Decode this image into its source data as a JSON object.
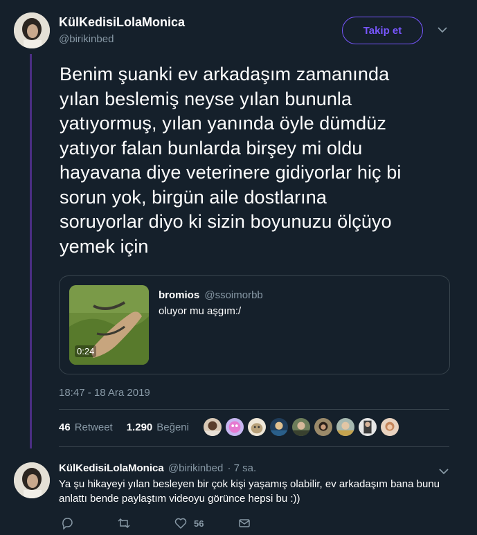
{
  "author": {
    "display_name": "KülKedisiLolaMonica",
    "handle": "@birikinbed"
  },
  "follow_label": "Takip et",
  "tweet": {
    "lines": [
      "Benim şuanki ev arkadaşım zamanında",
      "yılan beslemiş neyse yılan bununla",
      "yatıyormuş, yılan yanında öyle dümdüz",
      "yatıyor falan bunlarda birşey mi oldu",
      "hayavana diye veterinere gidiyorlar hiç bi",
      "sorun yok, birgün aile dostlarına",
      "soruyorlar diyo ki sizin boyunuzu ölçüyo",
      "yemek için"
    ],
    "timestamp": "18:47 - 18 Ara 2019"
  },
  "quote": {
    "name": "bromios",
    "handle": "@ssoimorbb",
    "text": "oluyor mu aşgım:/",
    "video_duration": "0:24"
  },
  "stats": {
    "retweets": "46",
    "retweets_label": "Retweet",
    "likes": "1.290",
    "likes_label": "Beğeni"
  },
  "reply": {
    "display_name": "KülKedisiLolaMonica",
    "handle": "@birikinbed",
    "time": "· 7 sa.",
    "lines": [
      "Ya şu hikayeyi yılan besleyen bir çok kişi yaşamış olabilir, ev arkadaşım bana bunu",
      "anlattı bende paylaştım videoyu görünce hepsi bu :))"
    ],
    "like_count": "56"
  },
  "icons": {
    "chevron": "chevron-down-icon",
    "reply": "reply-icon",
    "retweet": "retweet-icon",
    "like": "heart-icon",
    "dm": "envelope-icon"
  },
  "colors": {
    "background": "#15202b",
    "accent": "#7856ff",
    "muted": "#8899a6",
    "thread": "#4b2e83",
    "border": "#38444d"
  }
}
